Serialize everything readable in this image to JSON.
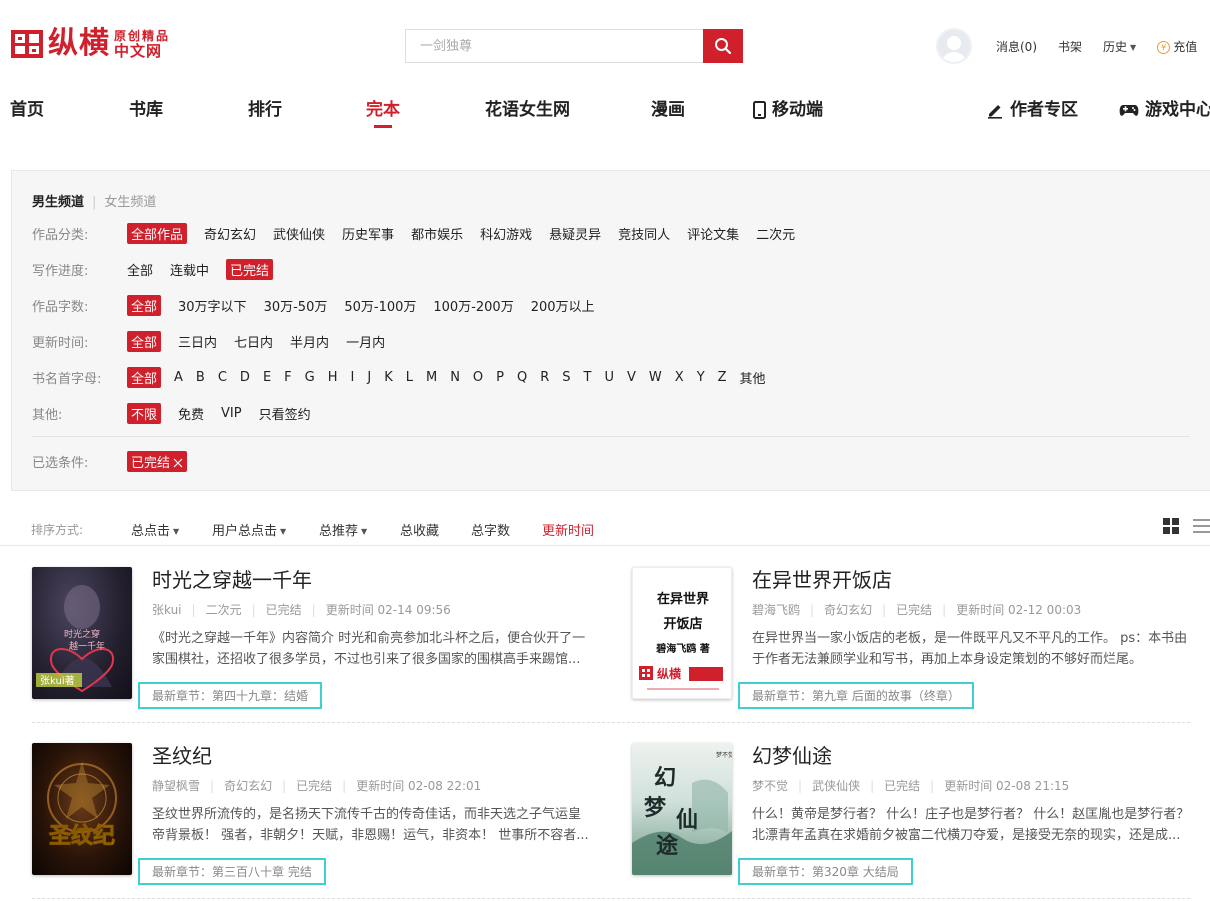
{
  "header": {
    "logo_main": "纵横",
    "logo_sub1": "原创精品",
    "logo_sub2": "中文网",
    "search_placeholder": "一剑独尊",
    "user_links": {
      "messages": "消息(0)",
      "bookshelf": "书架",
      "history": "历史",
      "recharge": "充值"
    }
  },
  "nav": {
    "home": "首页",
    "library": "书库",
    "rank": "排行",
    "finished": "完本",
    "female": "花语女生网",
    "comics": "漫画",
    "mobile": "移动端",
    "author": "作者专区",
    "games": "游戏中心"
  },
  "filter": {
    "channel_male": "男生频道",
    "channel_female": "女生频道",
    "category": {
      "label": "作品分类:",
      "options": [
        "全部作品",
        "奇幻玄幻",
        "武侠仙侠",
        "历史军事",
        "都市娱乐",
        "科幻游戏",
        "悬疑灵异",
        "竞技同人",
        "评论文集",
        "二次元"
      ]
    },
    "progress": {
      "label": "写作进度:",
      "options": [
        "全部",
        "连载中",
        "已完结"
      ]
    },
    "words": {
      "label": "作品字数:",
      "options": [
        "全部",
        "30万字以下",
        "30万-50万",
        "50万-100万",
        "100万-200万",
        "200万以上"
      ]
    },
    "update": {
      "label": "更新时间:",
      "options": [
        "全部",
        "三日内",
        "七日内",
        "半月内",
        "一月内"
      ]
    },
    "initial": {
      "label": "书名首字母:",
      "options": [
        "全部",
        "A",
        "B",
        "C",
        "D",
        "E",
        "F",
        "G",
        "H",
        "I",
        "J",
        "K",
        "L",
        "M",
        "N",
        "O",
        "P",
        "Q",
        "R",
        "S",
        "T",
        "U",
        "V",
        "W",
        "X",
        "Y",
        "Z",
        "其他"
      ]
    },
    "other": {
      "label": "其他:",
      "options": [
        "不限",
        "免费",
        "VIP",
        "只看签约"
      ]
    },
    "selected": {
      "label": "已选条件:",
      "chip": "已完结"
    }
  },
  "sort": {
    "label": "排序方式:",
    "total_clicks": "总点击",
    "user_clicks": "用户总点击",
    "total_recommend": "总推荐",
    "total_favorites": "总收藏",
    "total_words": "总字数",
    "update_time": "更新时间"
  },
  "books": [
    {
      "title": "时光之穿越一千年",
      "author": "张kui",
      "genre": "二次元",
      "status": "已完结",
      "updated": "更新时间  02-14 09:56",
      "desc": "《时光之穿越一千年》内容简介 时光和俞亮参加北斗杯之后，便合伙开了一家围棋社，还招收了很多学员，不过也引来了很多国家的围棋高手来踢馆...",
      "latest": "最新章节：第四十九章：结婚",
      "cover_text1": "时光之穿",
      "cover_text2": "越一千年",
      "cover_author": "张kui著"
    },
    {
      "title": "在异世界开饭店",
      "author": "碧海飞鸥",
      "genre": "奇幻玄幻",
      "status": "已完结",
      "updated": "更新时间  02-12 00:03",
      "desc": "在异世界当一家小饭店的老板，是一件既平凡又不平凡的工作。 ps：本书由于作者无法兼顾学业和写书，再加上本身设定策划的不够好而烂尾。",
      "latest": "最新章节：第九章 后面的故事（终章）",
      "cover_text1": "在异世界",
      "cover_text2": "开饭店",
      "cover_author": "碧海飞鸥 著"
    },
    {
      "title": "圣纹纪",
      "author": "静望枫雪",
      "genre": "奇幻玄幻",
      "status": "已完结",
      "updated": "更新时间  02-08 22:01",
      "desc": "圣纹世界所流传的，是名扬天下流传千古的传奇佳话，而非天选之子气运皇帝背景板！ 强者，非朝夕！天赋，非恩赐！运气，非资本！ 世事所不容者...",
      "latest": "最新章节：第三百八十章 完结",
      "cover_text1": "圣纹纪"
    },
    {
      "title": "幻梦仙途",
      "author": "梦不觉",
      "genre": "武侠仙侠",
      "status": "已完结",
      "updated": "更新时间  02-08 21:15",
      "desc": "什么！黄帝是梦行者？ 什么！庄子也是梦行者？ 什么！赵匡胤也是梦行者？北漂青年孟真在求婚前夕被富二代横刀夺爱，是接受无奈的现实，还是成...",
      "latest": "最新章节：第320章 大结局",
      "cover_text1": "幻",
      "cover_text2": "梦",
      "cover_text3": "仙",
      "cover_text4": "途",
      "cover_author": "梦不觉"
    }
  ]
}
